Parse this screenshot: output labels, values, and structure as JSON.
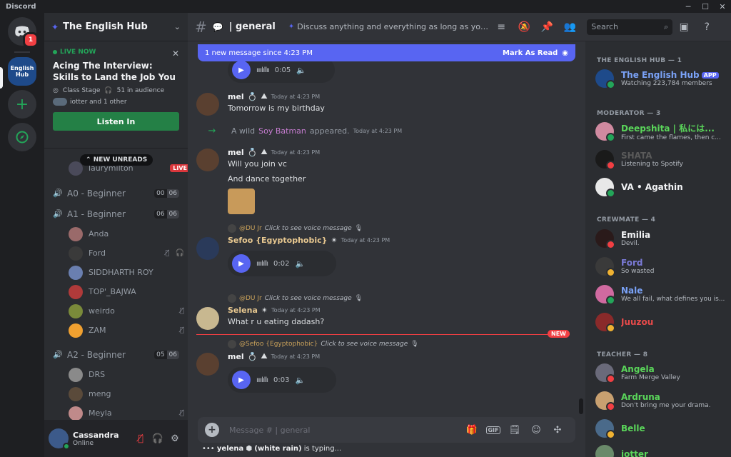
{
  "window": {
    "title": "Discord"
  },
  "servers": {
    "home_badge": "1",
    "hub_label": "English Hub"
  },
  "guild": {
    "name": "The English Hub"
  },
  "stage": {
    "live_label": "LIVE NOW",
    "title": "Acing The Interview: Skills to Land the Job You Want with...",
    "stage_name": "Class Stage",
    "audience": "51 in audience",
    "listeners": "iotter and 1 other",
    "button": "Listen In"
  },
  "channels": {
    "lounge_user": "laurymilton",
    "lounge_live": "LIVE",
    "new_unreads": "NEW UNREADS",
    "a0": {
      "name": "A0 - Beginner",
      "count_a": "00",
      "count_b": "06"
    },
    "a1": {
      "name": "A1 - Beginner",
      "count_a": "06",
      "count_b": "06"
    },
    "a1_users": [
      "Anda",
      "Ford",
      "SIDDHARTH ROY",
      "TOP'_BAJWA",
      "weirdo",
      "ZAM"
    ],
    "a2": {
      "name": "A2 - Beginner",
      "count_a": "05",
      "count_b": "06"
    },
    "a2_users": [
      "DRS",
      "meng",
      "Meyla"
    ]
  },
  "user": {
    "name": "Cassandra",
    "status": "Online"
  },
  "topbar": {
    "channel": "| general",
    "topic": "Discuss anything and everything as long as you k...",
    "search_placeholder": "Search"
  },
  "newbar": {
    "label": "1 new message since 4:23 PM",
    "action": "Mark As Read"
  },
  "messages": {
    "v0_dur": "0:05",
    "m1": {
      "author": "mel",
      "time": "Today at 4:23 PM",
      "text": "Tomorrow is my birthday"
    },
    "sys": {
      "prefix": "A wild",
      "who": "Soy Batman",
      "suffix": "appeared.",
      "time": "Today at 4:23 PM"
    },
    "m2": {
      "author": "mel",
      "time": "Today at 4:23 PM",
      "text1": "Will you join vc",
      "text2": "And dance together"
    },
    "r3": {
      "user": "@DU Jr",
      "text": "Click to see voice message"
    },
    "m3": {
      "author": "Sefoo {Egyptophobic}",
      "time": "Today at 4:23 PM",
      "dur": "0:02"
    },
    "r4": {
      "user": "@DU Jr",
      "text": "Click to see voice message"
    },
    "m4": {
      "author": "Selena",
      "time": "Today at 4:23 PM",
      "text": "What r u eating dadash?"
    },
    "new_tag": "NEW",
    "r5": {
      "user": "@Sefoo {Egyptophobic}",
      "text": "Click to see voice message"
    },
    "m5": {
      "author": "mel",
      "time": "Today at 4:23 PM",
      "dur": "0:03"
    }
  },
  "composer": {
    "placeholder": "Message # | general",
    "gif": "GIF"
  },
  "typing": {
    "user": "yelena",
    "extra": "(white rain)",
    "suffix": "is typing..."
  },
  "members": {
    "g_hub": "THE ENGLISH HUB — 1",
    "hub": {
      "name": "The English Hub",
      "tag": "APP",
      "status": "Watching 223,784 members"
    },
    "g_mod": "MODERATOR — 3",
    "deepshita": {
      "name": "Deepshita | 私には...",
      "status": "First came the flames, then c..."
    },
    "shata": {
      "name": "SHATA",
      "status": "Listening to Spotify"
    },
    "va": {
      "name": "VA • Agathin"
    },
    "g_crew": "CREWMATE — 4",
    "emilia": {
      "name": "Emilia",
      "status": "Devil."
    },
    "ford": {
      "name": "Ford",
      "status": "So wasted"
    },
    "nale": {
      "name": "Nale",
      "status": "We all fail, what defines you is..."
    },
    "juuzou": {
      "name": "Juuzou"
    },
    "g_teacher": "TEACHER — 8",
    "angela": {
      "name": "Angela",
      "status": "Farm Merge Valley"
    },
    "ardruna": {
      "name": "Ardruna",
      "status": "Don't bring me your drama."
    },
    "belle": {
      "name": "Belle"
    },
    "iotter": {
      "name": "iotter"
    }
  },
  "colors": {
    "accent": "#5865f2",
    "online": "#23a559",
    "dnd": "#f23f43"
  }
}
